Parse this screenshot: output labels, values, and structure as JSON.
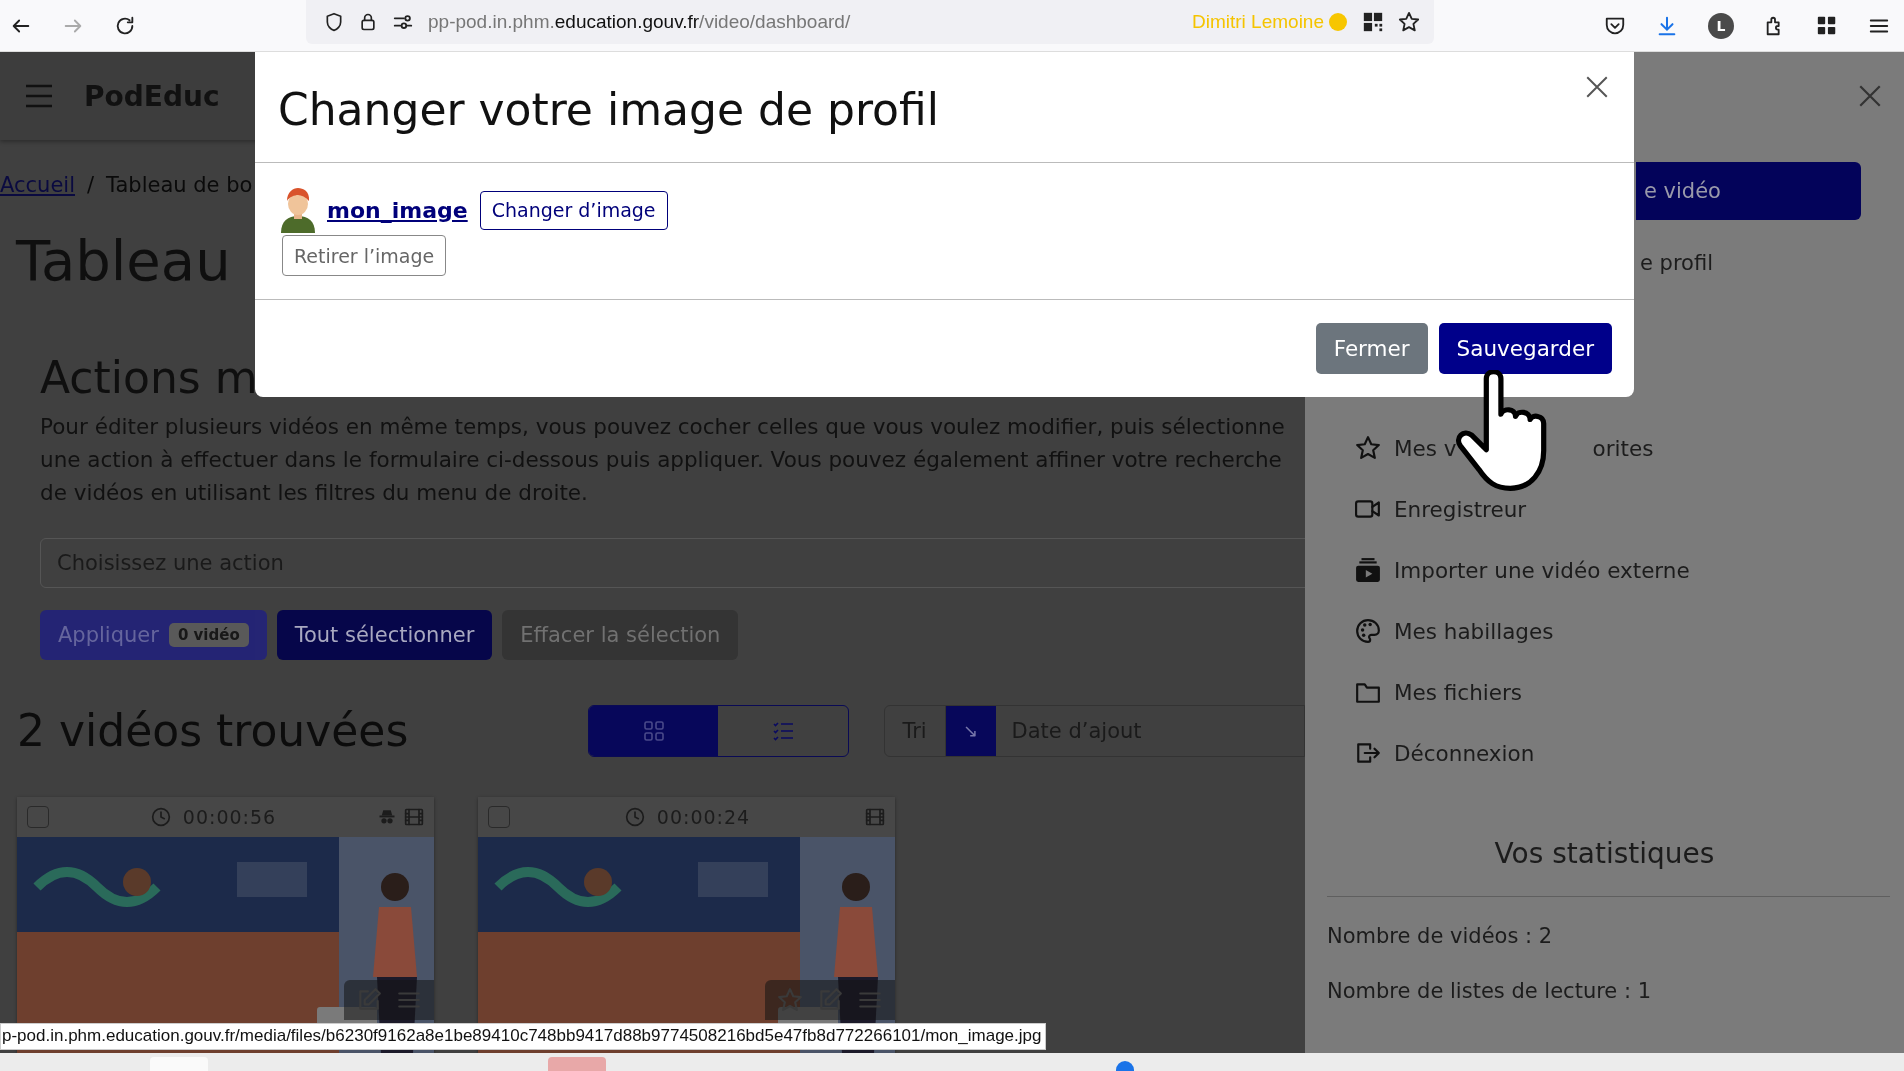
{
  "browser": {
    "url_prefix": "pp-pod.in.phm.",
    "url_domain": "education.gouv.fr",
    "url_path": "/video/dashboard/",
    "profile_name": "Dimitri Lemoine",
    "account_initial": "L"
  },
  "header": {
    "brand": "PodEduc"
  },
  "breadcrumb": {
    "link": "Accueil",
    "separator": "/",
    "current": "Tableau de bo"
  },
  "page_title": "Tableau",
  "actions": {
    "heading": "Actions m",
    "description_lines": [
      "Pour éditer plusieurs vidéos en même temps, vous pouvez cocher celles que vous voulez modifier, puis sélectionne",
      "une action à effectuer dans le formulaire ci-dessous puis appliquer. Vous pouvez également affiner votre recherche",
      "de vidéos en utilisant les filtres du menu de droite."
    ],
    "select_placeholder": "Choisissez une action",
    "buttons": [
      {
        "kind": "apply",
        "label": "Appliquer",
        "badge": "0 vidéo",
        "disabled": true
      },
      {
        "kind": "primary",
        "label": "Tout sélectionner",
        "disabled": false
      },
      {
        "kind": "secondary",
        "label": "Effacer la sélection",
        "disabled": true
      }
    ]
  },
  "results": {
    "title": "2 vidéos trouvées",
    "views": [
      {
        "kind": "grid",
        "selected": true
      },
      {
        "kind": "list",
        "selected": false
      }
    ],
    "sort": {
      "label": "Tri",
      "direction": "↘",
      "value": "Date d’ajout"
    }
  },
  "videos": [
    {
      "duration": "00:00:56",
      "checked": false,
      "restricted": true,
      "favorite_button": false
    },
    {
      "duration": "00:00:24",
      "checked": false,
      "restricted": false,
      "favorite_button": true
    }
  ],
  "sidebar": {
    "button_text": "e vidéo",
    "profile_text": "e profil",
    "items": [
      {
        "kind": "star",
        "label": "Mes v",
        "label_after_cursor": "orites"
      },
      {
        "kind": "camera",
        "label": "Enregistreur"
      },
      {
        "kind": "import",
        "label": "Importer une vidéo externe"
      },
      {
        "kind": "palette",
        "label": "Mes habillages"
      },
      {
        "kind": "folder",
        "label": "Mes fichiers"
      },
      {
        "kind": "logout",
        "label": "Déconnexion"
      }
    ],
    "stats": {
      "title": "Vos statistiques",
      "lines": [
        "Nombre de vidéos : 2",
        "Nombre de listes de lecture : 1"
      ]
    }
  },
  "modal": {
    "title": "Changer votre image de profil",
    "file_link": "mon_image",
    "change_button": "Changer d’image",
    "remove_button": "Retirer l’image",
    "buttons": [
      {
        "kind": "secondary",
        "label": "Fermer"
      },
      {
        "kind": "primary",
        "label": "Sauvegarder"
      }
    ]
  },
  "status_url": "p-pod.in.phm.education.gouv.fr/media/files/b6230f9162a8e1be89410c748bb9417d88b9774508216bd5e47fb8d772266101/mon_image.jpg"
}
